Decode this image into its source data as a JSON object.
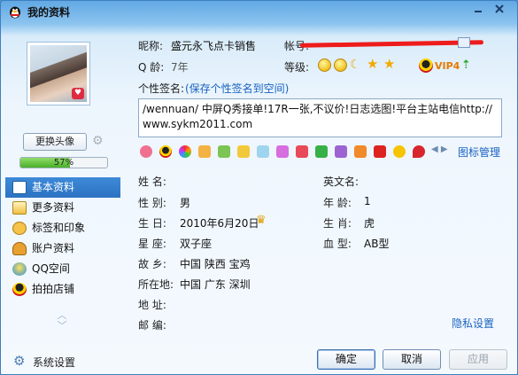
{
  "window": {
    "title": "我的资料"
  },
  "left": {
    "change_avatar": "更换头像",
    "progress_value": 57,
    "progress_text": "57%",
    "nav": [
      {
        "label": "基本资料",
        "icon": "profile-card-icon",
        "active": true
      },
      {
        "label": "更多资料",
        "icon": "more-info-icon",
        "active": false
      },
      {
        "label": "标签和印象",
        "icon": "tags-icon",
        "active": false
      },
      {
        "label": "账户资料",
        "icon": "account-icon",
        "active": false
      },
      {
        "label": "QQ空间",
        "icon": "qzone-icon",
        "active": false
      },
      {
        "label": "拍拍店铺",
        "icon": "paipai-shop-icon",
        "active": false
      }
    ]
  },
  "profile": {
    "nickname_label": "昵称:",
    "nickname": "盛元永飞点卡销售",
    "account_label": "帐号:",
    "qage_label": "Q 龄:",
    "qage": "7年",
    "level_label": "等级:",
    "vip": "VIP4",
    "signature_label": "个性签名:",
    "save_signature": "(保存个性签名到空间)",
    "signature": "/wennuan/ 中屏Q秀接单!17R一张,不议价!日志选图!平台主站电信http://www.sykm2011.com",
    "icon_manage": "图标管理"
  },
  "fields": {
    "name_label": "姓    名:",
    "name": "",
    "english_name_label": "英文名:",
    "english_name": "",
    "gender_label": "性    别:",
    "gender": "男",
    "age_label": "年    龄:",
    "age": "1",
    "birthday_label": "生    日:",
    "birthday": "2010年6月20日",
    "zodiac_label": "生    肖:",
    "zodiac": "虎",
    "constellation_label": "星    座:",
    "constellation": "双子座",
    "blood_label": "血    型:",
    "blood": "AB型",
    "hometown_label": "故    乡:",
    "hometown": "中国  陕西  宝鸡",
    "location_label": "所在地:",
    "location": "中国  广东  深圳",
    "address_label": "地    址:",
    "address": "",
    "postcode_label": "邮    编:",
    "postcode": "",
    "privacy": "隐私设置"
  },
  "footer": {
    "system_settings": "系统设置",
    "ok": "确定",
    "cancel": "取消",
    "apply": "应用"
  }
}
